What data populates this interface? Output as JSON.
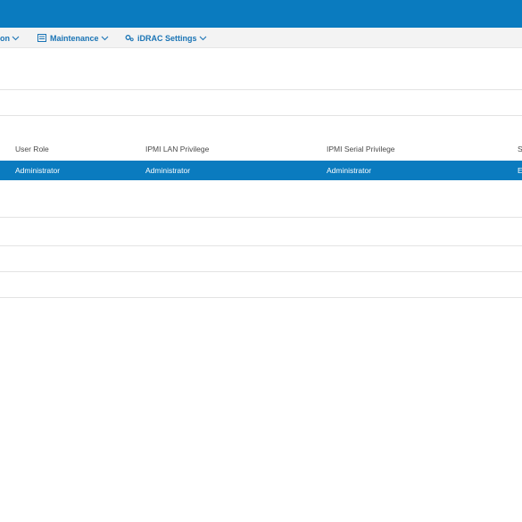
{
  "nav": {
    "items": [
      {
        "label": "on",
        "icon": "partial-menu-icon"
      },
      {
        "label": "Maintenance",
        "icon": "maintenance-icon"
      },
      {
        "label": "iDRAC Settings",
        "icon": "settings-gears-icon"
      }
    ]
  },
  "table": {
    "headers": [
      "User Role",
      "IPMI LAN Privilege",
      "IPMI Serial Privilege",
      "S"
    ],
    "rows": [
      [
        "Administrator",
        "Administrator",
        "Administrator",
        "E"
      ]
    ]
  },
  "colors": {
    "brand_blue": "#0a7bbf",
    "nav_text": "#1a74b5"
  }
}
